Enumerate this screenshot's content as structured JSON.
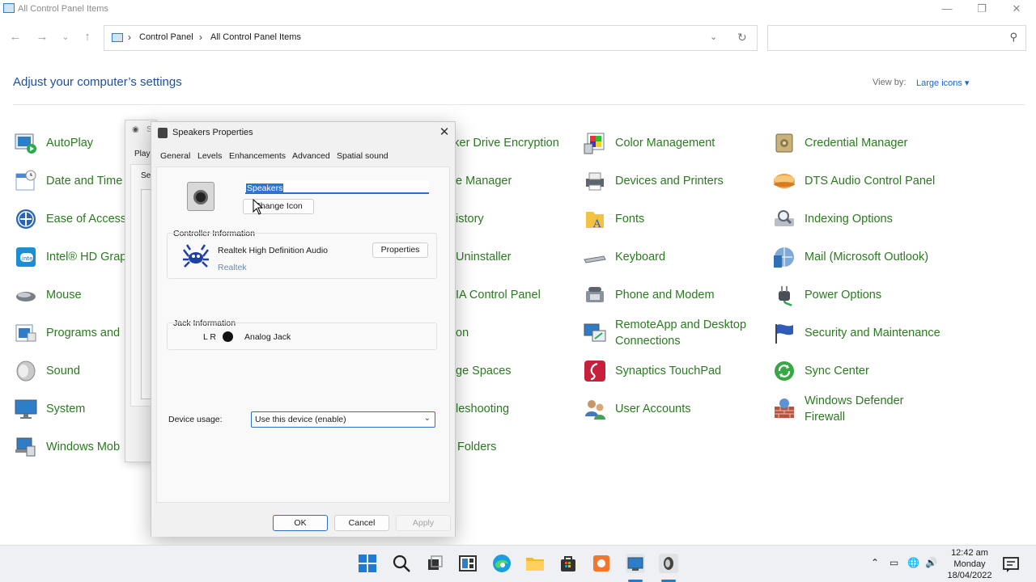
{
  "window": {
    "title": "All Control Panel Items",
    "minimize": "—",
    "maximize": "❐",
    "close": "✕"
  },
  "nav": {
    "back": "←",
    "forward": "→",
    "recent": "⌄",
    "up": "↑",
    "breadcrumb": [
      "Control Panel",
      "All Control Panel Items"
    ],
    "search_placeholder": ""
  },
  "header": {
    "title": "Adjust your computer’s settings",
    "view_by_label": "View by:",
    "view_by_value": "Large icons ▾"
  },
  "items": {
    "col1": [
      "AutoPlay",
      "Date and Time",
      "Ease of Access",
      "Intel® HD Grap",
      "Mouse",
      "Programs and",
      "Sound",
      "System",
      "Windows Mob"
    ],
    "col2": [
      "cker Drive Encryption",
      "e Manager",
      "istory",
      "Uninstaller",
      "IA Control Panel",
      "on",
      "ge Spaces",
      "leshooting",
      "Folders"
    ],
    "col3": [
      "Color Management",
      "Devices and Printers",
      "Fonts",
      "Keyboard",
      "Phone and Modem",
      "RemoteApp and Desktop Connections",
      "Synaptics TouchPad",
      "User Accounts"
    ],
    "col4": [
      "Credential Manager",
      "DTS Audio Control Panel",
      "Indexing Options",
      "Mail (Microsoft Outlook)",
      "Power Options",
      "Security and Maintenance",
      "Sync Center",
      "Windows Defender Firewall"
    ]
  },
  "items_split": {
    "remoteapp_l1": "RemoteApp and Desktop",
    "remoteapp_l2": "Connections",
    "defender_l1": "Windows Defender",
    "defender_l2": "Firewall"
  },
  "bg_dialog": {
    "title_fragment": "S",
    "tab_fragment": "Play",
    "label_fragment": "Se"
  },
  "dialog": {
    "title": "Speakers Properties",
    "tabs": [
      "General",
      "Levels",
      "Enhancements",
      "Advanced",
      "Spatial sound"
    ],
    "device_name": "Speakers",
    "change_icon": "Change Icon",
    "controller_header": "Controller Information",
    "controller_name": "Realtek High Definition Audio",
    "controller_vendor": "Realtek",
    "properties": "Properties",
    "jack_header": "Jack Information",
    "jack_channels": "L R",
    "jack_name": "Analog Jack",
    "device_usage_label": "Device usage:",
    "device_usage_value": "Use this device (enable)",
    "ok": "OK",
    "cancel": "Cancel",
    "apply": "Apply"
  },
  "taskbar": {
    "time": "12:42 am",
    "day": "Monday",
    "date": "18/04/2022"
  },
  "colors": {
    "link_green": "#2a7a1f",
    "heading_blue": "#1e4f9c",
    "accent_blue": "#2c6fc9"
  }
}
